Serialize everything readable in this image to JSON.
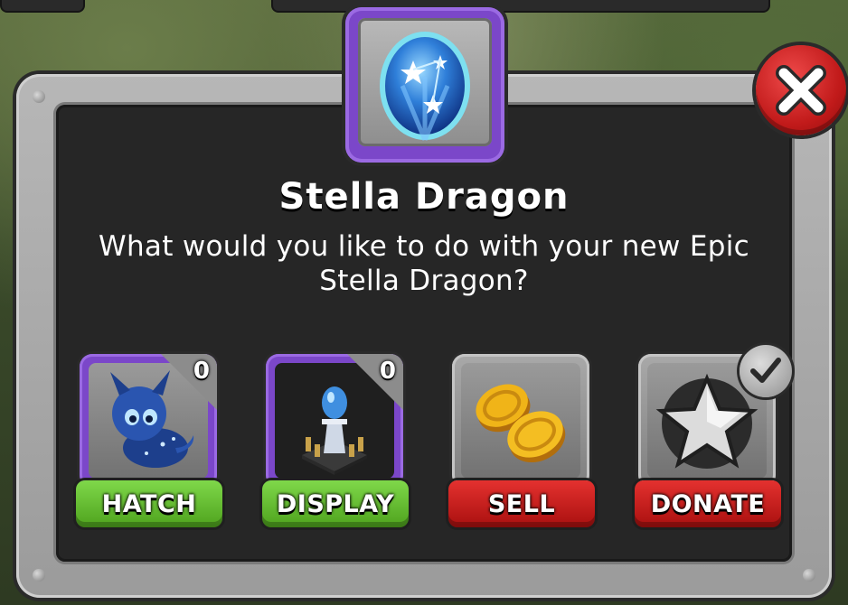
{
  "dialog": {
    "title": "Stella Dragon",
    "message_line1": "What would you like to do with your new Epic",
    "message_line2": "Stella Dragon?"
  },
  "colors": {
    "rarity_frame": "#7b47c9",
    "action_green": "#5cb82a",
    "action_red": "#c41a19"
  },
  "options": [
    {
      "label": "HATCH",
      "count": "0",
      "icon": "dragon-icon"
    },
    {
      "label": "DISPLAY",
      "count": "0",
      "icon": "egg-pedestal-icon"
    },
    {
      "label": "SELL",
      "icon": "gold-coins-icon"
    },
    {
      "label": "DONATE",
      "icon": "star-icon",
      "badge": "checkmark-icon"
    }
  ]
}
